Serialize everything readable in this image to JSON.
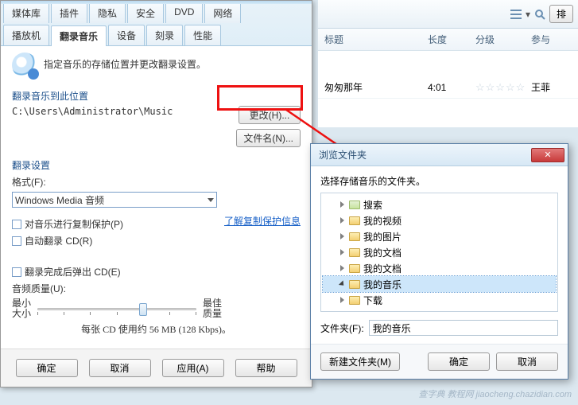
{
  "tabs_row1": [
    "媒体库",
    "插件",
    "隐私",
    "安全",
    "DVD",
    "网络"
  ],
  "tabs_row2": [
    "播放机",
    "翻录音乐",
    "设备",
    "刻录",
    "性能"
  ],
  "active_tab": "翻录音乐",
  "page_desc": "指定音乐的存储位置并更改翻录设置。",
  "loc_group": "翻录音乐到此位置",
  "loc_path": "C:\\Users\\Administrator\\Music",
  "btn_change": "更改(H)...",
  "btn_filename": "文件名(N)...",
  "set_group": "翻录设置",
  "fmt_label": "格式(F):",
  "fmt_value": "Windows Media 音频",
  "chk_copy": "对音乐进行复制保护(P)",
  "chk_auto": "自动翻录 CD(R)",
  "link_copy": "了解复制保护信息",
  "chk_eject": "翻录完成后弹出 CD(E)",
  "qual_label": "音频质量(U):",
  "qual_min_a": "最小",
  "qual_min_b": "大小",
  "qual_max_a": "最佳",
  "qual_max_b": "质量",
  "qual_info": "每张 CD 使用约 56 MB (128 Kbps)。",
  "btn_ok": "确定",
  "btn_cancel": "取消",
  "btn_apply": "应用(A)",
  "btn_help": "帮助",
  "lib_sort": "排",
  "lib_cols": {
    "title": "标题",
    "len": "长度",
    "rate": "分级",
    "art": "参与"
  },
  "lib_row": {
    "title": "匆匆那年",
    "len": "4:01",
    "rate": "☆☆☆☆☆",
    "art": "王菲"
  },
  "dlg_title": "浏览文件夹",
  "dlg_prompt": "选择存储音乐的文件夹。",
  "tree": [
    {
      "label": "搜索",
      "sel": false
    },
    {
      "label": "我的视频",
      "sel": false
    },
    {
      "label": "我的图片",
      "sel": false
    },
    {
      "label": "我的文档",
      "sel": false
    },
    {
      "label": "我的文档",
      "sel": false
    },
    {
      "label": "我的音乐",
      "sel": true
    },
    {
      "label": "下载",
      "sel": false
    }
  ],
  "dlg_folder_label": "文件夹(F):",
  "dlg_folder_value": "我的音乐",
  "dlg_newfolder": "新建文件夹(M)",
  "dlg_ok": "确定",
  "dlg_cancel": "取消",
  "watermark": "查字典 教程网  jiaocheng.chazidian.com"
}
